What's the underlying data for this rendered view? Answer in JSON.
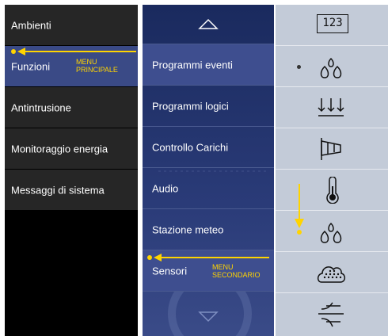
{
  "main_menu": {
    "items": [
      {
        "label": "Ambienti"
      },
      {
        "label": "Funzioni",
        "active": true
      },
      {
        "label": "Antintrusione"
      },
      {
        "label": "Monitoraggio energia"
      },
      {
        "label": "Messaggi di sistema"
      }
    ]
  },
  "secondary_menu": {
    "items": [
      {
        "label": "Programmi eventi"
      },
      {
        "label": "Programmi logici"
      },
      {
        "label": "Controllo Carichi"
      },
      {
        "label": "Audio"
      },
      {
        "label": "Stazione meteo"
      },
      {
        "label": "Sensori",
        "active": true
      }
    ]
  },
  "icon_column": {
    "icons": [
      "numeric-123-icon",
      "water-drops-icon",
      "rain-icon",
      "windsock-icon",
      "thermometer-icon",
      "water-drops-icon",
      "cloud-hail-icon",
      "wind-icon"
    ],
    "counter_text": "123"
  },
  "annotations": {
    "main_label_line1": "MENU",
    "main_label_line2": "PRINCIPALE",
    "secondary_label_line1": "MENU",
    "secondary_label_line2": "SECONDARIO"
  },
  "colors": {
    "annotation": "#ffd400",
    "main_active": "#3a4a86",
    "secondary_background": "#2a3b78",
    "icon_background": "#c3cbd8"
  }
}
